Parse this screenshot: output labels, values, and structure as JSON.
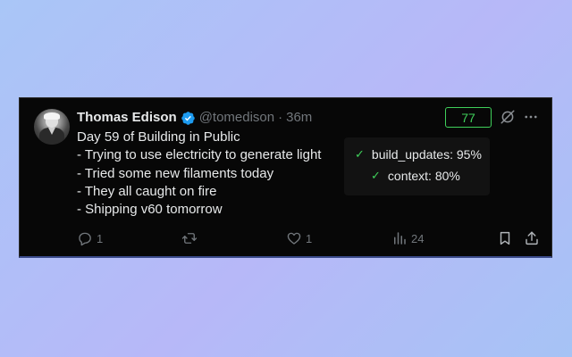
{
  "tweet": {
    "author_name": "Thomas Edison",
    "handle": "@tomedison",
    "separator": "·",
    "time": "36m",
    "lines": [
      "Day 59 of Building in Public",
      "- Trying to use electricity to generate light",
      "- Tried some new filaments today",
      "- They all caught on fire",
      "- Shipping v60 tomorrow"
    ],
    "verified_color": "#1d9bf0"
  },
  "score_badge": {
    "value": "77",
    "color": "#3fcf5a"
  },
  "popup": {
    "items": [
      {
        "label": "build_updates: 95%",
        "icon": "check-icon"
      },
      {
        "label": "context: 80%",
        "icon": "check-icon"
      }
    ]
  },
  "actions": {
    "reply_count": "1",
    "repost_count": "",
    "like_count": "1",
    "views_count": "24"
  },
  "icons": {
    "verified": "verified-badge-icon",
    "grok": "slashed-circle-icon",
    "more": "more-dots-icon",
    "reply": "reply-icon",
    "repost": "repost-icon",
    "like": "heart-icon",
    "views": "views-bar-chart-icon",
    "bookmark": "bookmark-icon",
    "share": "share-icon"
  }
}
